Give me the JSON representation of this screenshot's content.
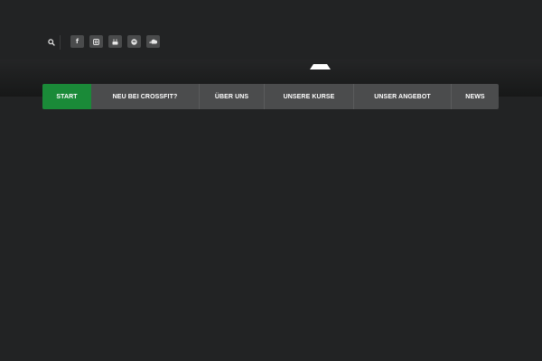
{
  "header": {
    "search_icon": "search-icon",
    "social_links": [
      {
        "name": "facebook-icon",
        "glyph": "f"
      },
      {
        "name": "instagram-icon",
        "glyph": ""
      },
      {
        "name": "youtube-icon",
        "glyph": ""
      },
      {
        "name": "spotify-icon",
        "glyph": ""
      },
      {
        "name": "soundcloud-icon",
        "glyph": ""
      }
    ],
    "logo": "logo-mark"
  },
  "nav": {
    "items": [
      {
        "label": "START",
        "active": true
      },
      {
        "label": "NEU BEI CROSSFIT?",
        "active": false
      },
      {
        "label": "ÜBER UNS",
        "active": false
      },
      {
        "label": "UNSERE KURSE",
        "active": false
      },
      {
        "label": "UNSER ANGEBOT",
        "active": false
      },
      {
        "label": "NEWS",
        "active": false
      }
    ]
  },
  "colors": {
    "background": "#222324",
    "nav_background": "#4b4c4d",
    "active_accent": "#1a8a38",
    "text": "#ffffff"
  }
}
